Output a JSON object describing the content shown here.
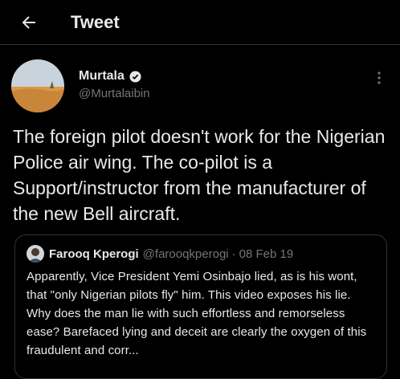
{
  "header": {
    "back_icon": "arrow-left-icon",
    "title": "Tweet"
  },
  "tweet": {
    "author": {
      "name": "Murtala",
      "handle": "@Murtalaibin",
      "verified": true,
      "verified_icon": "verified-badge-icon",
      "avatar_icon": "landscape-avatar"
    },
    "more_icon": "more-vertical-icon",
    "text": "The foreign pilot doesn't work for the Nigerian Police air wing. The co-pilot is a Support/instructor from the manufacturer of the new Bell aircraft."
  },
  "quoted_tweet": {
    "author": {
      "name": "Farooq Kperogi",
      "handle": "@farooqkperogi",
      "avatar_icon": "portrait-avatar"
    },
    "separator": "·",
    "date": "08 Feb 19",
    "text": "Apparently, Vice President Yemi Osinbajo lied, as is his wont, that \"only Nigerian pilots fly\" him. This video exposes his lie. Why does the man lie with such effortless and remorseless ease? Barefaced lying and deceit are clearly the oxygen of this fraudulent and corr..."
  },
  "colors": {
    "background": "#000000",
    "text_primary": "#e7e9ea",
    "text_secondary": "#71767b",
    "border": "#2f3336"
  }
}
